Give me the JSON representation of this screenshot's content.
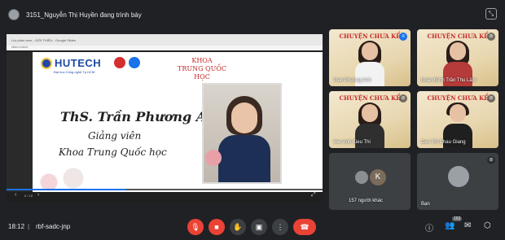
{
  "top": {
    "presenting": "3151_Nguyễn Thị Huyền đang trình bày"
  },
  "screen": {
    "browser_title": "Lộc phần xem - GIỚI THIỆU - Google Slides",
    "browser_url": "slides.hutech",
    "slide": {
      "logo_text": "HUTECH",
      "logo_sub": "Đại học Công nghệ Tp.HCM",
      "dept_line1": "KHOA",
      "dept_line2": "TRUNG QUỐC HỌC",
      "name": "ThS. Trần Phương Anh",
      "role": "Giảng viên",
      "dept": "Khoa Trung Quốc học"
    },
    "controls": {
      "page": "6 / 18",
      "prev_icon": "‹",
      "next_icon": "›",
      "fullscreen_icon": "⤢"
    },
    "progress_percent": 38
  },
  "tiles": [
    {
      "banner": "CHUYỆN CHƯA KỂ",
      "name": "Tran Phuong Anh"
    },
    {
      "banner": "CHUYỆN CHƯA KỂ",
      "name": "Đoàn Đình Trần Thu Lâm"
    },
    {
      "banner": "CHUYỆN CHƯA KỂ",
      "name": "Van Anh Kieu Thi"
    },
    {
      "banner": "CHUYỆN CHƯA KỂ",
      "name": "Dao Thi Chau Giang"
    }
  ],
  "others": {
    "avatar_letter": "K",
    "label": "157 người khác"
  },
  "self": {
    "label": "Bạn"
  },
  "bottom": {
    "time": "18:12",
    "separator": "|",
    "meeting_code": "rbf-sadc-jnp",
    "participants_count": "163"
  },
  "colors": {
    "background": "#202124",
    "tile": "#3c4043",
    "danger": "#ea4335",
    "accent": "#1a73e8",
    "slide_red": "#c62828",
    "slide_blue": "#1e4aa6"
  }
}
